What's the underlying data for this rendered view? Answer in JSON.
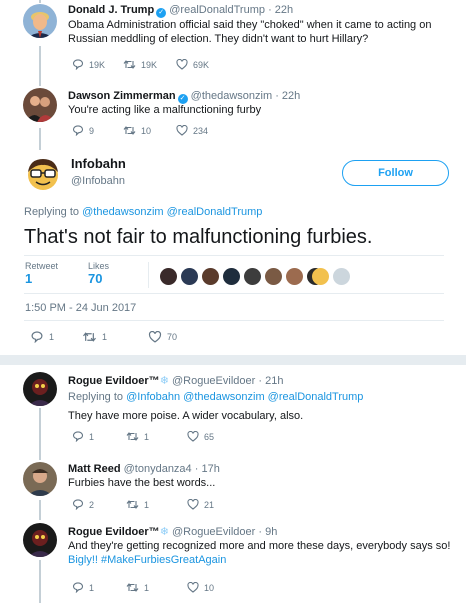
{
  "tweet1": {
    "name": "Donald J. Trump",
    "handle": "@realDonaldTrump",
    "time": "· 22h",
    "text_line1": "Obama Administration official said they \"choked\" when it came to acting on",
    "text_line2": "Russian meddling of election. They didn't want to hurt Hillary?",
    "replies": "19K",
    "retweets": "19K",
    "likes": "69K"
  },
  "tweet2": {
    "name": "Dawson Zimmerman",
    "handle": "@thedawsonzim",
    "time": "· 22h",
    "text": "You're acting like a malfunctioning furby",
    "replies": "9",
    "retweets": "10",
    "likes": "234"
  },
  "main": {
    "name": "Infobahn",
    "handle": "@Infobahn",
    "follow_label": "Follow",
    "replying_prefix": "Replying to",
    "replying_to": "@thedawsonzim @realDonaldTrump",
    "text": "That's not fair to malfunctioning furbies.",
    "retweets_label": "Retweet",
    "retweets_value": "1",
    "likes_label": "Likes",
    "likes_value": "70",
    "timestamp": "1:50 PM - 24 Jun 2017",
    "replies": "1",
    "retweets": "1",
    "likes": "70"
  },
  "reply1": {
    "name": "Rogue Evildoer™",
    "snowflake": "❄",
    "handle": "@RogueEvildoer",
    "time": "· 21h",
    "replying_prefix": "Replying to",
    "replying_to": "@Infobahn @thedawsonzim @realDonaldTrump",
    "text": "They have more poise. A wider vocabulary, also.",
    "replies": "1",
    "retweets": "1",
    "likes": "65"
  },
  "reply2": {
    "name": "Matt Reed",
    "handle": "@tonydanza4",
    "time": "· 17h",
    "text": "Furbies have the best words...",
    "replies": "2",
    "retweets": "1",
    "likes": "21"
  },
  "reply3": {
    "name": "Rogue Evildoer™",
    "snowflake": "❄",
    "handle": "@RogueEvildoer",
    "time": "· 9h",
    "text_line1": "And they're getting recognized more and more these days, everybody says so!",
    "text_line2": "Bigly!! #MakeFurbiesGreatAgain",
    "replies": "1",
    "retweets": "1",
    "likes": "10"
  },
  "colors": {
    "accent": "#1da1f2",
    "link": "#1b95e0",
    "muted": "#657786",
    "thread_line": "#c4cfd6"
  }
}
